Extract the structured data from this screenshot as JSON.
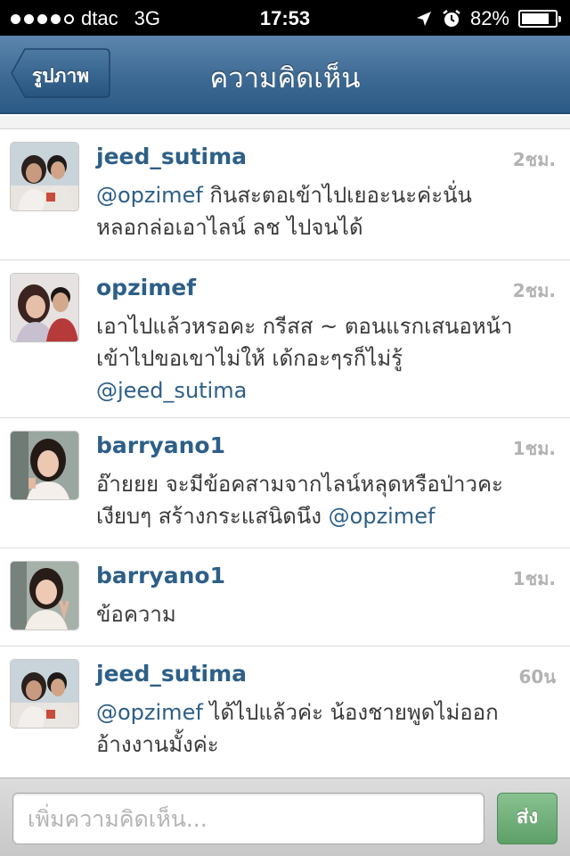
{
  "status_bar": {
    "carrier": "dtac",
    "network": "3G",
    "time": "17:53",
    "battery": "82%",
    "battery_level": 0.82,
    "signal_bars_filled": 4,
    "signal_bars_total": 5,
    "icons": [
      "location-arrow-icon",
      "alarm-clock-icon",
      "battery-icon"
    ]
  },
  "nav": {
    "back_label": "รูปภาพ",
    "title": "ความคิดเห็น"
  },
  "comments": [
    {
      "username": "jeed_sutima",
      "time": "2ชม.",
      "line1": {
        "mention": "@opzimef",
        "text": " กินสะตอเข้าไปเยอะนะค่ะนั่น"
      },
      "line2": {
        "text": "หลอกล่อเอาไลน์ ลช ไปจนได้"
      }
    },
    {
      "username": "opzimef",
      "time": "2ชม.",
      "line1": {
        "text": "เอาไปแล้วหรอคะ กรีสส ~ ตอนแรกเสนอหน้า"
      },
      "line2": {
        "text": "เข้าไปขอเขาไม่ให้ เด้กอะๆรก็ไม่รู้"
      },
      "line3": {
        "mention": "@jeed_sutima"
      }
    },
    {
      "username": "barryano1",
      "time": "1ชม.",
      "line1": {
        "text": "อ๊ายยย จะมีข้อคสามจากไลน์หลุดหรือป่าวคะ"
      },
      "line2": {
        "text": "เงียบๆ สร้างกระแสนิดนึง ",
        "mention": "@opzimef"
      }
    },
    {
      "username": "barryano1",
      "time": "1ชม.",
      "line1": {
        "text": "ข้อความ"
      }
    },
    {
      "username": "jeed_sutima",
      "time": "60น",
      "line1": {
        "mention": "@opzimef",
        "text": " ได้ไปแล้วค่ะ น้องชายพูดไม่ออก"
      },
      "line2": {
        "text": "อ้างงานมั้งค่ะ"
      }
    }
  ],
  "compose": {
    "placeholder": "เพิ่มความคิดเห็น...",
    "value": "",
    "send_label": "ส่ง"
  },
  "colors": {
    "nav_bar": "#3d6a94",
    "username": "#2d5f88",
    "send_button": "#6aa874"
  }
}
